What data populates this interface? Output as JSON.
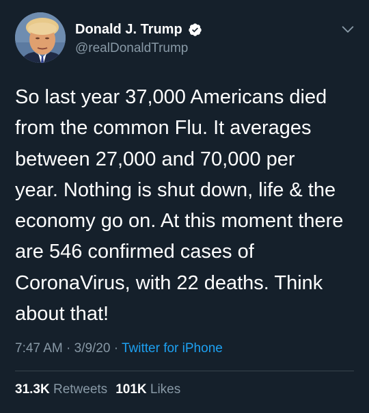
{
  "tweet": {
    "author": {
      "display_name": "Donald J. Trump",
      "handle": "@realDonaldTrump",
      "verified": true
    },
    "text": "So last year 37,000 Americans died\nfrom the common Flu. It averages\nbetween 27,000 and 70,000 per\nyear. Nothing is shut down, life & the\neconomy go on. At this moment there\nare 546 confirmed cases of\nCoronaVirus, with 22 deaths. Think\nabout that!",
    "time": "7:47 AM",
    "separator": " · ",
    "date": "3/9/20",
    "source": "Twitter for iPhone",
    "stats": {
      "retweets_count": "31.3K",
      "retweets_label": "Retweets",
      "likes_count": "101K",
      "likes_label": "Likes"
    }
  },
  "theme": {
    "background": "#15202b",
    "text": "#ffffff",
    "muted": "#8899a6",
    "link": "#1da1f2",
    "divider": "#38444d"
  },
  "icons": {
    "verified": "verified-badge-icon",
    "more": "chevron-down-icon"
  }
}
